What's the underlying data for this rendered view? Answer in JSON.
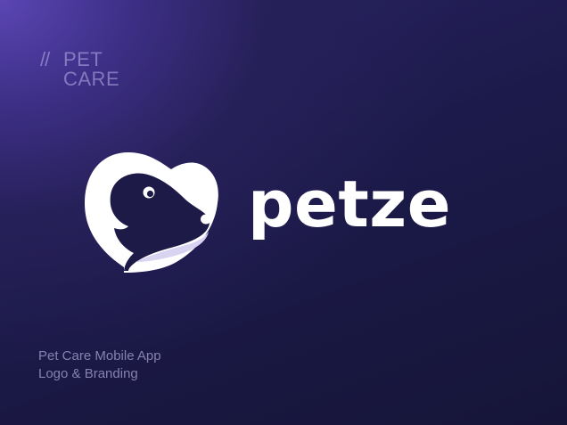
{
  "tagline": {
    "slashes": "//",
    "line1": "PET",
    "line2": "CARE"
  },
  "brand": {
    "name": "petze",
    "logo_icon": "dog-head-heart-icon"
  },
  "caption": {
    "line1": "Pet Care Mobile App",
    "line2": "Logo & Branding"
  },
  "colors": {
    "background_top_left": "#5b46b3",
    "background_bottom": "#161538",
    "logo": "#ffffff",
    "logo_shadow": "#d9d3f2",
    "text_muted": "#bdb4eb"
  }
}
